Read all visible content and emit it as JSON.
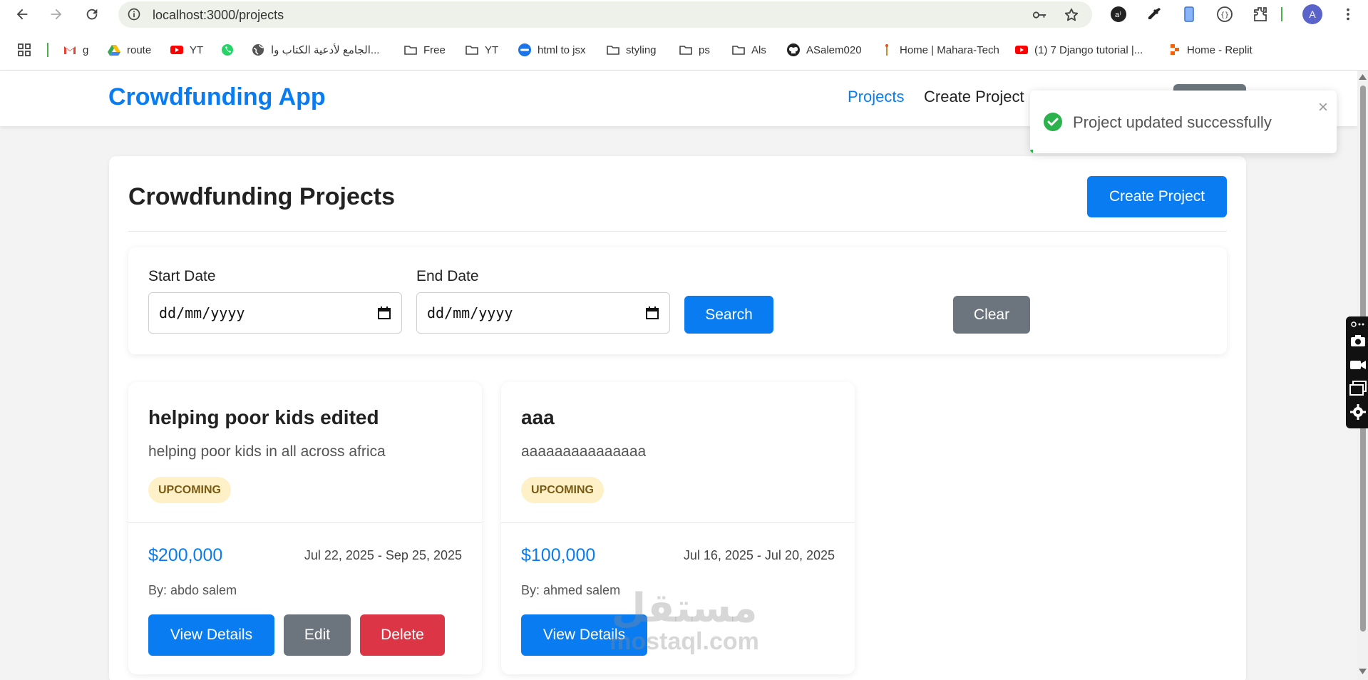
{
  "browser": {
    "url": "localhost:3000/projects",
    "profile_initial": "A",
    "bookmarks": [
      {
        "label": "g",
        "icon": "gmail-icon"
      },
      {
        "label": "route",
        "icon": "drive-icon"
      },
      {
        "label": "YT",
        "icon": "youtube-icon"
      },
      {
        "label": "",
        "icon": "whatsapp-icon"
      },
      {
        "label": "الجامع لأدعية الكتاب وا...",
        "icon": "globe-icon"
      },
      {
        "label": "Free",
        "icon": "folder-icon"
      },
      {
        "label": "YT",
        "icon": "folder-icon"
      },
      {
        "label": "html to jsx",
        "icon": "link-icon"
      },
      {
        "label": "styling",
        "icon": "folder-icon"
      },
      {
        "label": "ps",
        "icon": "folder-icon"
      },
      {
        "label": "Als",
        "icon": "folder-icon"
      },
      {
        "label": "ASalem020",
        "icon": "github-icon"
      },
      {
        "label": "Home | Mahara-Tech",
        "icon": "mahara-icon"
      },
      {
        "label": "(1) 7 Django tutorial |...",
        "icon": "youtube-icon"
      },
      {
        "label": "Home - Replit",
        "icon": "replit-icon"
      }
    ]
  },
  "app": {
    "brand": "Crowdfunding App",
    "nav": {
      "projects": "Projects",
      "create_project": "Create Project"
    },
    "page_title": "Crowdfunding Projects",
    "create_button": "Create Project",
    "filter": {
      "start_label": "Start Date",
      "end_label": "End Date",
      "start_value": "dd/mm/yyyy",
      "end_value": "dd/mm/yyyy",
      "search_button": "Search",
      "clear_button": "Clear"
    },
    "projects": [
      {
        "title": "helping poor kids edited",
        "description": "helping poor kids in all across africa",
        "status": "UPCOMING",
        "goal": "$200,000",
        "dates": "Jul 22, 2025 - Sep 25, 2025",
        "owner": "By: abdo salem",
        "view_button": "View Details",
        "edit_button": "Edit",
        "delete_button": "Delete"
      },
      {
        "title": "aaa",
        "description": "aaaaaaaaaaaaaaa",
        "status": "UPCOMING",
        "goal": "$100,000",
        "dates": "Jul 16, 2025 - Jul 20, 2025",
        "owner": "By: ahmed salem",
        "view_button": "View Details"
      }
    ],
    "toast": {
      "message": "Project updated successfully",
      "close": "×",
      "progress": 0.01
    }
  },
  "watermark": {
    "arabic": "مستقل",
    "latin": "mostaql.com"
  },
  "colors": {
    "primary": "#0a7cf2",
    "secondary": "#6c757d",
    "danger": "#dc3545",
    "badge_bg": "#fff1c7",
    "success": "#2bb24c"
  }
}
